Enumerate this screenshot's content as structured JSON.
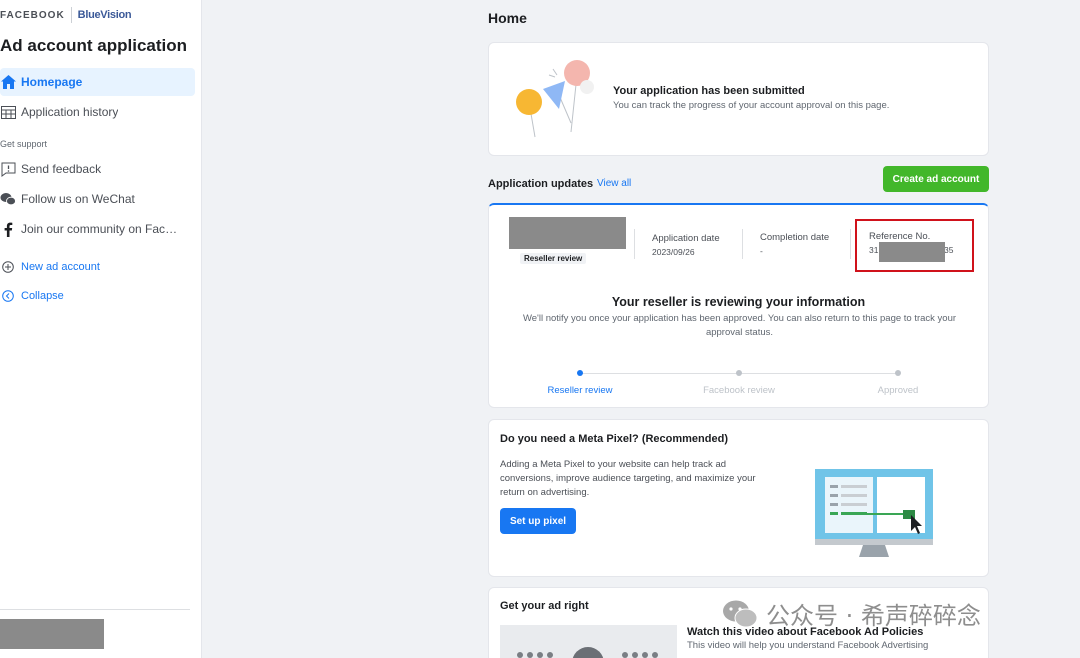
{
  "brand": {
    "facebook": "FACEBOOK",
    "partner": "BlueVision"
  },
  "sidebar": {
    "app_title": "Ad account application",
    "items": [
      {
        "label": "Homepage",
        "icon": "home-icon"
      },
      {
        "label": "Application history",
        "icon": "table-icon"
      }
    ],
    "support_label": "Get support",
    "support_items": [
      {
        "label": "Send feedback",
        "icon": "feedback-icon"
      },
      {
        "label": "Follow us on WeChat",
        "icon": "wechat-icon"
      },
      {
        "label": "Join our community on Facebook",
        "icon": "facebook-icon"
      }
    ],
    "links": [
      {
        "label": "New ad account",
        "icon": "plus-circle-icon"
      },
      {
        "label": "Collapse",
        "icon": "collapse-icon"
      }
    ]
  },
  "main": {
    "page_title": "Home",
    "submitted": {
      "title": "Your application has been submitted",
      "desc": "You can track the progress of your account approval on this page."
    },
    "updates": {
      "label": "Application updates",
      "view_all": "View all",
      "create_button": "Create ad account"
    },
    "status": {
      "badge": "Reseller review",
      "application_date_label": "Application date",
      "application_date": "2023/09/26",
      "completion_date_label": "Completion date",
      "completion_date": "-",
      "reference_label": "Reference No.",
      "reference_prefix": "31",
      "reference_suffix": "35",
      "title": "Your reseller is reviewing your information",
      "desc": "We'll notify you once your application has been approved. You can also return to this page to track your approval status.",
      "steps": [
        "Reseller review",
        "Facebook review",
        "Approved"
      ]
    },
    "pixel": {
      "title": "Do you need a Meta Pixel? (Recommended)",
      "desc": "Adding a Meta Pixel to your website can help track ad conversions, improve audience targeting, and maximize your return on advertising.",
      "button": "Set up pixel"
    },
    "adright": {
      "title": "Get your ad right",
      "video_title": "Watch this video about Facebook Ad Policies",
      "video_desc": "This video will help you understand Facebook Advertising"
    }
  },
  "watermark": "公众号 · 希声碎碎念"
}
